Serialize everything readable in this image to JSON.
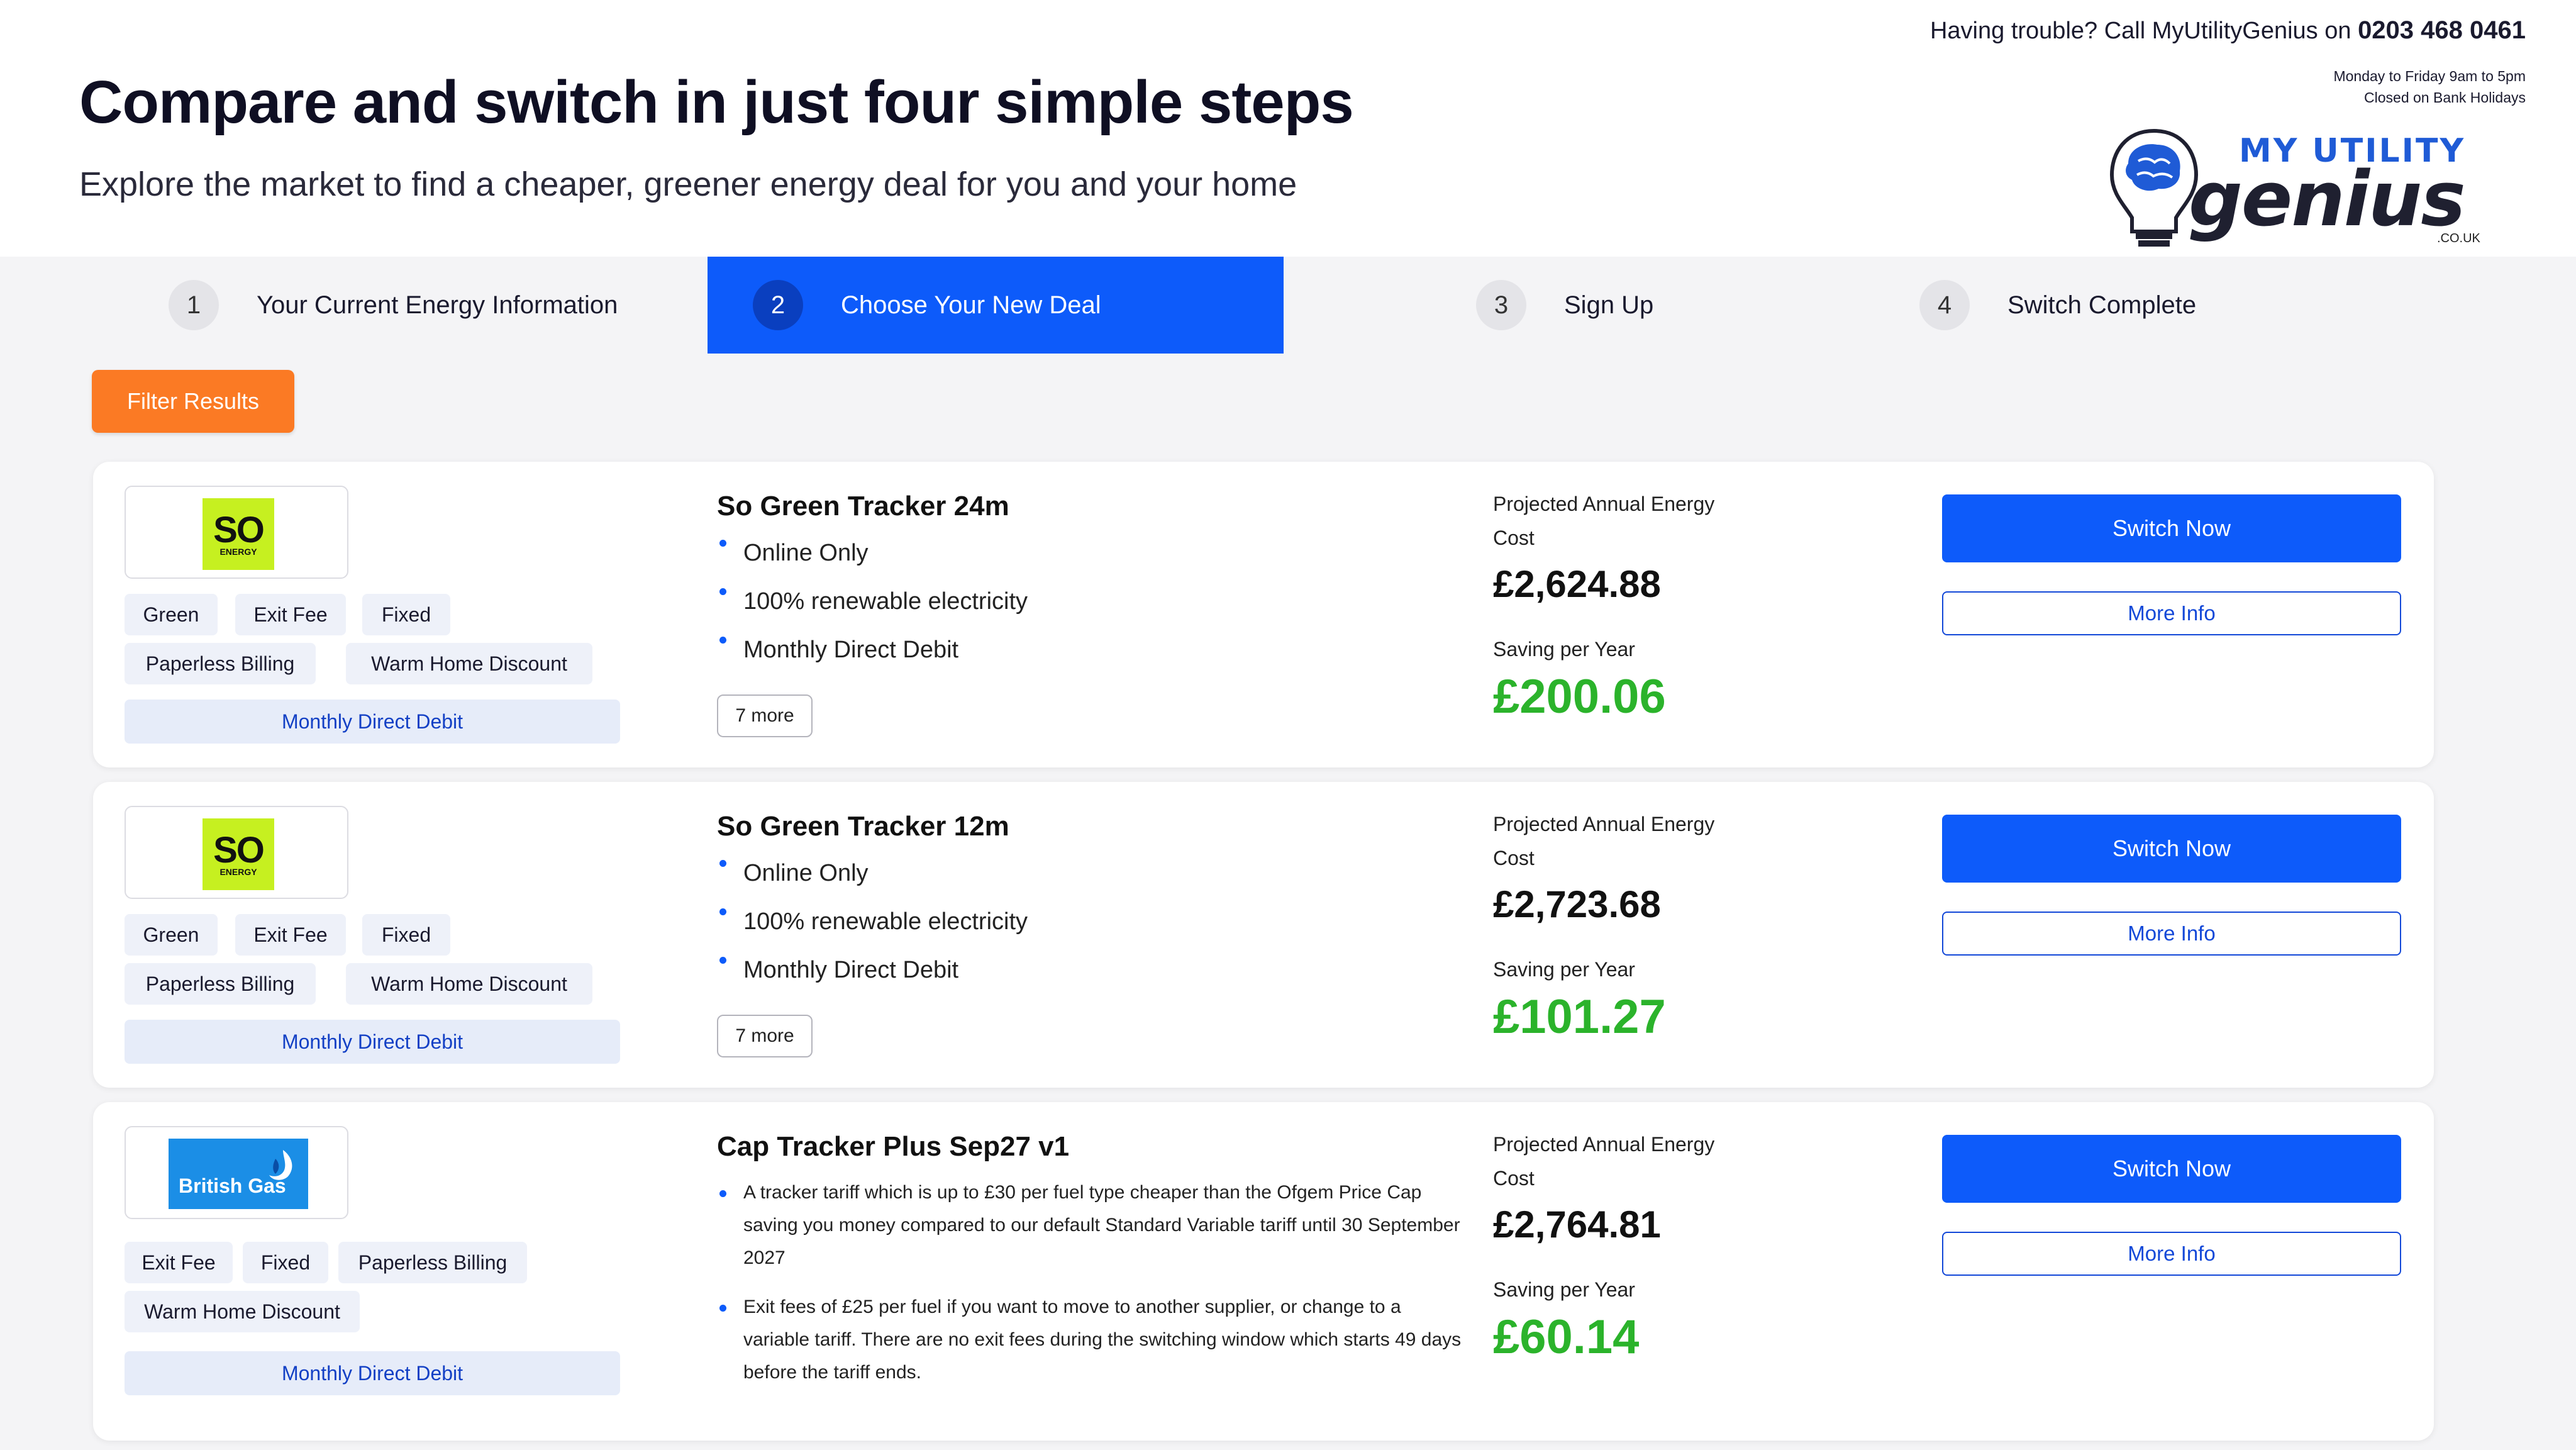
{
  "page": {
    "title": "Compare and switch in just four simple steps",
    "subtitle": "Explore the market to find a cheaper, greener energy deal for you and your home"
  },
  "helpline": {
    "prefix": "Having trouble? Call MyUtilityGenius on",
    "phone": "0203 468 0461",
    "hours_line1": "Monday to Friday 9am to 5pm",
    "hours_line2": "Closed on Bank Holidays"
  },
  "logo": {
    "top": "MY UTILITY",
    "main": "genius",
    "domain": ".CO.UK"
  },
  "steps": [
    {
      "num": "1",
      "label": "Your Current Energy Information",
      "active": false
    },
    {
      "num": "2",
      "label": "Choose Your New Deal",
      "active": true
    },
    {
      "num": "3",
      "label": "Sign Up",
      "active": false
    },
    {
      "num": "4",
      "label": "Switch Complete",
      "active": false
    }
  ],
  "filter_label": "Filter Results",
  "colors": {
    "accent_blue": "#0d5bfa",
    "filter_orange": "#fb7a24",
    "saving_green": "#2bb32b",
    "so_energy_lime": "#c6f020",
    "british_gas_blue": "#1b8ee6"
  },
  "deals": [
    {
      "supplier": "So Energy",
      "logo_text": {
        "so": "SO",
        "energy": "ENERGY"
      },
      "tags": [
        "Green",
        "Exit Fee",
        "Fixed",
        "Paperless Billing",
        "Warm Home Discount"
      ],
      "billing": "Monthly Direct Debit",
      "name": "So Green Tracker 24m",
      "features": [
        "Online Only",
        "100% renewable electricity",
        "Monthly Direct Debit"
      ],
      "more": "7 more",
      "cost_label": "Projected Annual Energy Cost",
      "cost": "£2,624.88",
      "saving_label": "Saving per Year",
      "saving": "£200.06",
      "switch_label": "Switch Now",
      "info_label": "More Info"
    },
    {
      "supplier": "So Energy",
      "logo_text": {
        "so": "SO",
        "energy": "ENERGY"
      },
      "tags": [
        "Green",
        "Exit Fee",
        "Fixed",
        "Paperless Billing",
        "Warm Home Discount"
      ],
      "billing": "Monthly Direct Debit",
      "name": "So Green Tracker 12m",
      "features": [
        "Online Only",
        "100% renewable electricity",
        "Monthly Direct Debit"
      ],
      "more": "7 more",
      "cost_label": "Projected Annual Energy Cost",
      "cost": "£2,723.68",
      "saving_label": "Saving per Year",
      "saving": "£101.27",
      "switch_label": "Switch Now",
      "info_label": "More Info"
    },
    {
      "supplier": "British Gas",
      "logo_text": {
        "name": "British Gas"
      },
      "tags": [
        "Exit Fee",
        "Fixed",
        "Paperless Billing",
        "Warm Home Discount"
      ],
      "billing": "Monthly Direct Debit",
      "name": "Cap Tracker Plus Sep27 v1",
      "features": [
        "A tracker tariff which is up to £30 per fuel type cheaper than the Ofgem Price Cap saving you money compared to our default Standard Variable tariff until 30 September 2027",
        "Exit fees of £25 per fuel if you want to move to another supplier, or change to a variable tariff. There are no exit fees during the switching window which starts 49 days before the tariff ends."
      ],
      "cost_label": "Projected Annual Energy Cost",
      "cost": "£2,764.81",
      "saving_label": "Saving per Year",
      "saving": "£60.14",
      "switch_label": "Switch Now",
      "info_label": "More Info"
    }
  ]
}
